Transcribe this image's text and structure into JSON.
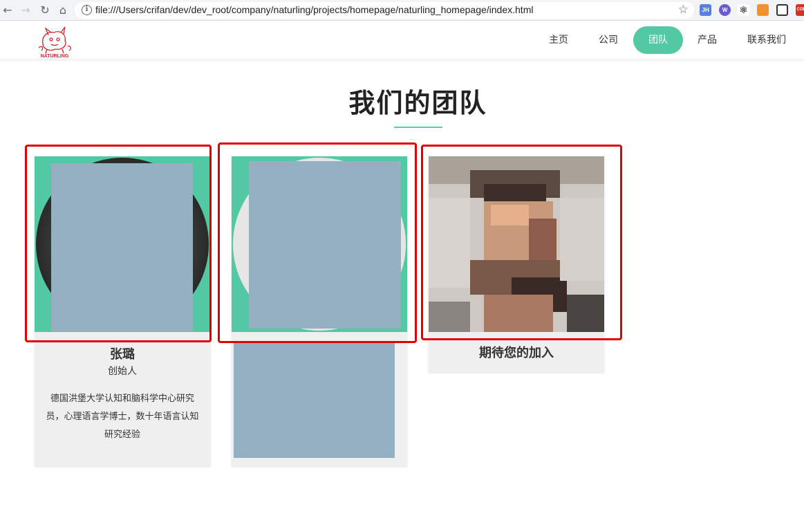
{
  "browser": {
    "url": "file:///Users/crifan/dev/dev_root/company/naturling/projects/homepage/naturling_homepage/index.html",
    "extensions": [
      {
        "label": "JH",
        "color": "#5b7fdc"
      },
      {
        "label": "W",
        "color": "#6a5acd"
      },
      {
        "label": "",
        "color": "#ffffff"
      },
      {
        "label": "",
        "color": "#f0932b"
      },
      {
        "label": "",
        "color": "#ffffff"
      },
      {
        "label": "COM",
        "color": "#d93025"
      }
    ]
  },
  "header": {
    "logo_text": "NATURLING",
    "nav": [
      {
        "label": "主页",
        "active": false
      },
      {
        "label": "公司",
        "active": false
      },
      {
        "label": "团队",
        "active": true
      },
      {
        "label": "产品",
        "active": false
      },
      {
        "label": "联系我们",
        "active": false
      }
    ]
  },
  "team": {
    "title": "我们的团队",
    "members": [
      {
        "name": "张璐",
        "role": "创始人",
        "desc": "德国洪堡大学认知和脑科学中心研究员，心理语言学博士，数十年语言认知研究经验"
      },
      {
        "name": "",
        "role": "",
        "desc": ""
      },
      {
        "name": "期待您的加入",
        "role": "",
        "desc": ""
      }
    ]
  },
  "colors": {
    "accent": "#52c9a3",
    "redaction": "#95b1c1",
    "highlight_frame": "#e00000",
    "card_bg": "#efefef"
  }
}
